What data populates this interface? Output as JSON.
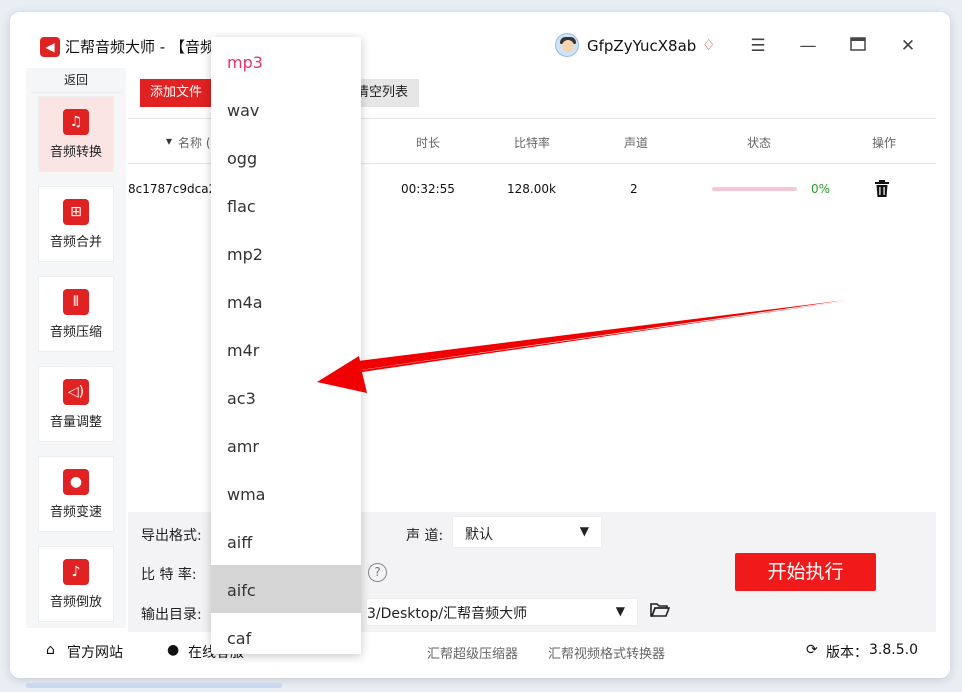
{
  "app": {
    "title": "汇帮音频大师  - 【音频转换】",
    "username": "GfpZyYucX8ab"
  },
  "sidebar": {
    "back_label": "返回",
    "items": [
      {
        "label": "音频转换",
        "icon": "audio-convert-icon",
        "active": true
      },
      {
        "label": "音频合并",
        "icon": "audio-merge-icon",
        "active": false
      },
      {
        "label": "音频压缩",
        "icon": "audio-compress-icon",
        "active": false
      },
      {
        "label": "音量调整",
        "icon": "volume-adjust-icon",
        "active": false
      },
      {
        "label": "音频变速",
        "icon": "audio-speed-icon",
        "active": false
      },
      {
        "label": "音频倒放",
        "icon": "audio-reverse-icon",
        "active": false
      }
    ]
  },
  "toolbar": {
    "add_label": "添加文件",
    "clear_label": "清空列表"
  },
  "table": {
    "headers": {
      "name": "名称 (",
      "duration": "时长",
      "bitrate": "比特率",
      "channel": "声道",
      "status": "状态",
      "action": "操作"
    },
    "rows": [
      {
        "name": "8c1787c9dca2",
        "duration": "00:32:55",
        "bitrate": "128.00k",
        "channel": "2",
        "progress": 0,
        "percent": "0%"
      }
    ]
  },
  "settings": {
    "format_label": "导出格式:",
    "channel_label": "声 道:",
    "channel_value": "默认",
    "bitrate_label": "比 特 率:",
    "output_label": "输出目录:",
    "output_path": "3/Desktop/汇帮音频大师"
  },
  "start_label": "开始执行",
  "footer": {
    "website": "官方网站",
    "online_service": "在线客服",
    "link1": "汇帮超级压缩器",
    "link2": "汇帮视频格式转换器",
    "version_label": "版本：",
    "version": "3.8.5.0"
  },
  "dropdown": {
    "options": [
      "mp3",
      "wav",
      "ogg",
      "flac",
      "mp2",
      "m4a",
      "m4r",
      "ac3",
      "amr",
      "wma",
      "aiff",
      "aifc",
      "caf"
    ],
    "selected": "mp3",
    "hovered": "aifc"
  },
  "colors": {
    "brand_red": "#e02222",
    "selected_option": "#e8336e",
    "percent_green": "#2a9d2a"
  }
}
